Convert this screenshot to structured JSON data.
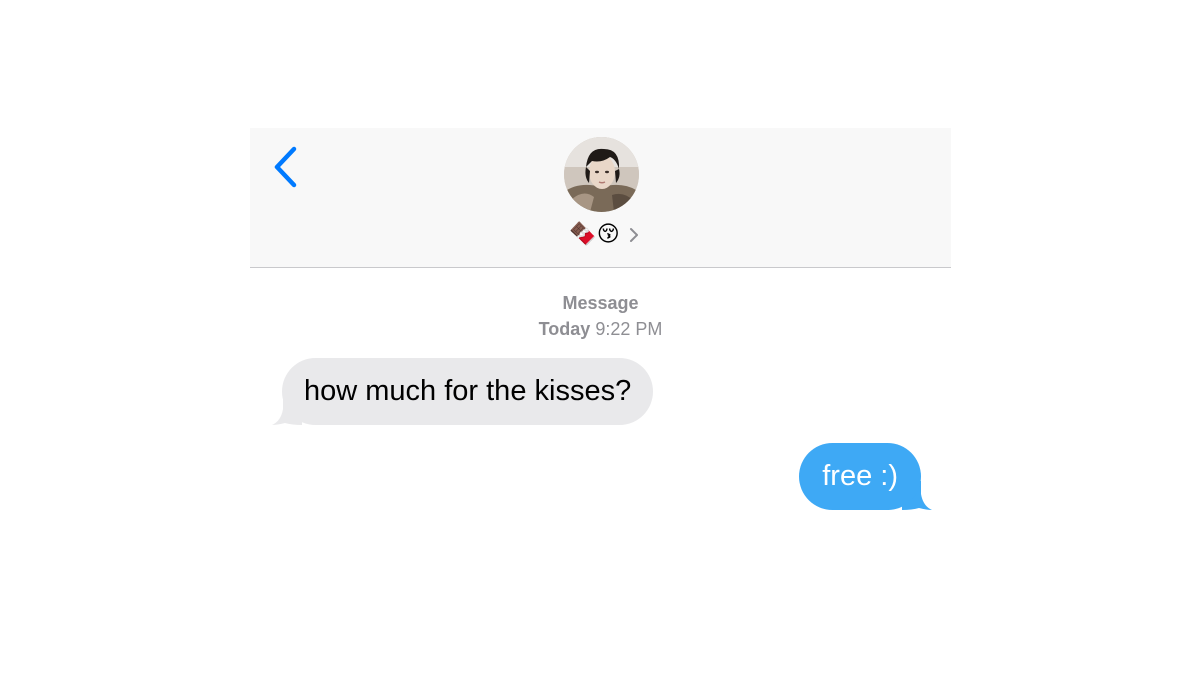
{
  "header": {
    "back_icon": "chevron-left-icon",
    "contact_emoji": "🍫😚",
    "details_icon": "chevron-right-icon"
  },
  "meta": {
    "service": "Message",
    "day": "Today",
    "time": "9:22 PM"
  },
  "messages": [
    {
      "direction": "incoming",
      "text": "how much for the kisses?"
    },
    {
      "direction": "outgoing",
      "text": "free :)"
    }
  ],
  "colors": {
    "accent": "#007aff",
    "incoming_bubble": "#e9e9eb",
    "outgoing_bubble": "#3ea9f5",
    "meta_text": "#8e8e93",
    "header_bg": "#f8f8f8"
  }
}
